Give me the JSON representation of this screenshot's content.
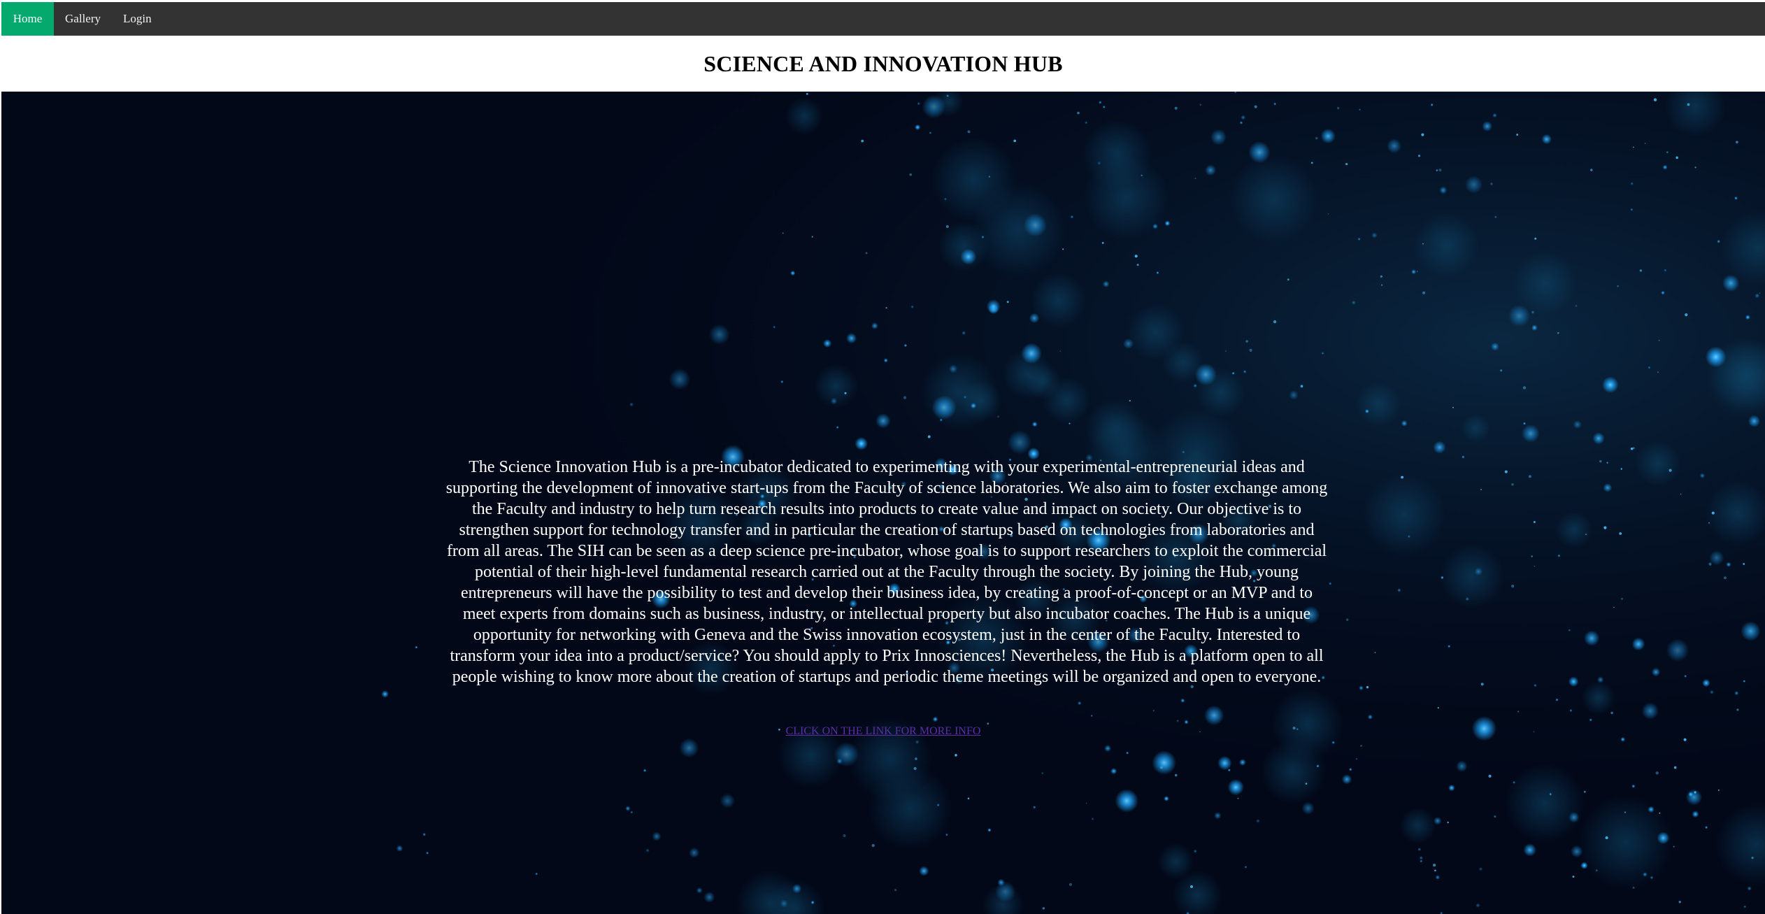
{
  "nav": {
    "items": [
      {
        "label": "Home",
        "active": true
      },
      {
        "label": "Gallery",
        "active": false
      },
      {
        "label": "Login",
        "active": false
      }
    ]
  },
  "header": {
    "title": "SCIENCE AND INNOVATION HUB"
  },
  "hero": {
    "paragraph": "The Science Innovation Hub is a pre-incubator dedicated to experimenting with your experimental-entrepreneurial ideas and supporting the development of innovative start-ups from the Faculty of science laboratories. We also aim to foster exchange among the Faculty and industry to help turn research results into products to create value and impact on society. Our objective is to strengthen support for technology transfer and in particular the creation of startups based on technologies from laboratories and from all areas. The SIH can be seen as a deep science pre-incubator, whose goal is to support researchers to exploit the commercial potential of their high-level fundamental research carried out at the Faculty through the society. By joining the Hub, young entrepreneurs will have the possibility to test and develop their business idea, by creating a proof-of-concept or an MVP and to meet experts from domains such as business, industry, or intellectual property but also incubator coaches. The Hub is a unique opportunity for networking with Geneva and the Swiss innovation ecosystem, just in the center of the Faculty. Interested to transform your idea into a product/service? You should apply to Prix Innosciences! Nevertheless, the Hub is a platform open to all people wishing to know more about the creation of startups and periodic theme meetings will be organized and open to everyone.",
    "link_label": "CLICK ON THE LINK FOR MORE INFO"
  },
  "colors": {
    "nav_bg": "#333333",
    "nav_active": "#04AA6D",
    "hero_bg": "#020818",
    "particle": "#1ea7ff",
    "link": "#5b2ea6"
  }
}
